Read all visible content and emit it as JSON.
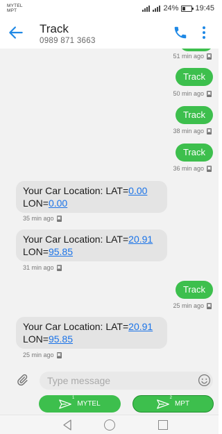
{
  "status_bar": {
    "carrier_top": "MYTEL",
    "carrier_bottom": "MPT",
    "battery_percent": "24%",
    "time": "19:45"
  },
  "header": {
    "title": "Track",
    "phone_number": "0989 871 3663",
    "back_icon": "arrow-left-icon",
    "call_icon": "phone-icon",
    "menu_icon": "more-vert-icon"
  },
  "messages": {
    "m0": {
      "meta": "51 min ago"
    },
    "m1": {
      "text": "Track",
      "meta": "50 min ago"
    },
    "m2": {
      "text": "Track",
      "meta": "38 min ago"
    },
    "m3": {
      "text": "Track",
      "meta": "36 min ago"
    },
    "m4": {
      "prefix": "Your Car Location: LAT=",
      "lat": "0.00",
      "lon_label": "LON=",
      "lon": "0.00",
      "meta": "35 min ago"
    },
    "m5": {
      "prefix": "Your Car Location: LAT=",
      "lat": "20.91",
      "lon_label": "LON=",
      "lon": "95.85",
      "meta": "31 min ago"
    },
    "m6": {
      "text": "Track",
      "meta": "25 min ago"
    },
    "m7": {
      "prefix": "Your Car Location: LAT=",
      "lat": "20.91",
      "lon_label": "LON=",
      "lon": "95.85",
      "meta": "25 min ago"
    }
  },
  "composer": {
    "placeholder": "Type message",
    "sim1_label": "MYTEL",
    "sim1_index": "1",
    "sim2_label": "MPT",
    "sim2_index": "2"
  },
  "colors": {
    "accent_green": "#3dbf4d",
    "accent_blue": "#1e88e5",
    "link_blue": "#1a73e8"
  }
}
